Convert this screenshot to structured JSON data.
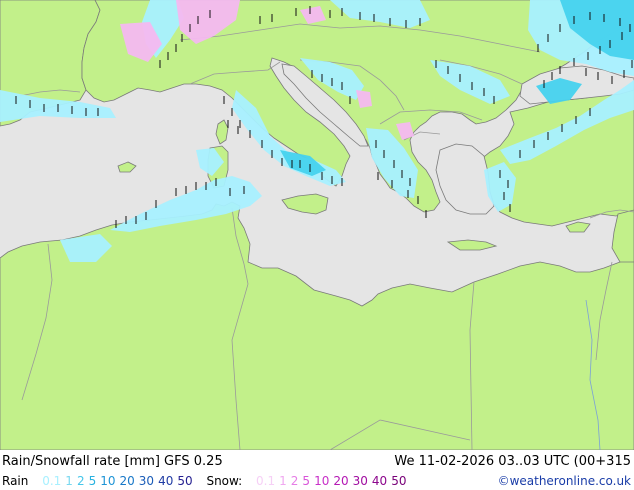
{
  "map": {
    "colors": {
      "sea": "#e5e5e5",
      "land": "#c2f08a",
      "border": "#9a9a9a",
      "coast": "#7a7a7a",
      "rain_light": "#a8f0ff",
      "rain_mid": "#46d2ee",
      "snow_light": "#f4b8f0",
      "tick": "#111111"
    }
  },
  "footer": {
    "title_left": "Rain/Snowfall rate [mm] GFS 0.25",
    "title_right": "We 11-02-2026 03..03 UTC (00+315",
    "rain_label": "Rain",
    "rain_values": [
      "0.1",
      "1",
      "2",
      "5",
      "10",
      "20",
      "30",
      "40",
      "50"
    ],
    "rain_colors": [
      "#a8f0ff",
      "#7ad8f0",
      "#46c6ea",
      "#28b2e0",
      "#1e94d6",
      "#1878c8",
      "#1a5cb8",
      "#203ca4",
      "#241f90"
    ],
    "snow_label": "Snow:",
    "snow_values": [
      "0.1",
      "1",
      "2",
      "5",
      "10",
      "20",
      "30",
      "40",
      "50"
    ],
    "snow_colors": [
      "#f6d0f6",
      "#f0a8f0",
      "#e67ee6",
      "#d854d8",
      "#c830c8",
      "#b418b4",
      "#a00ca0",
      "#8c068c",
      "#780078"
    ],
    "credit": "©weatheronline.co.uk",
    "credit_color": "#1a3da8"
  }
}
